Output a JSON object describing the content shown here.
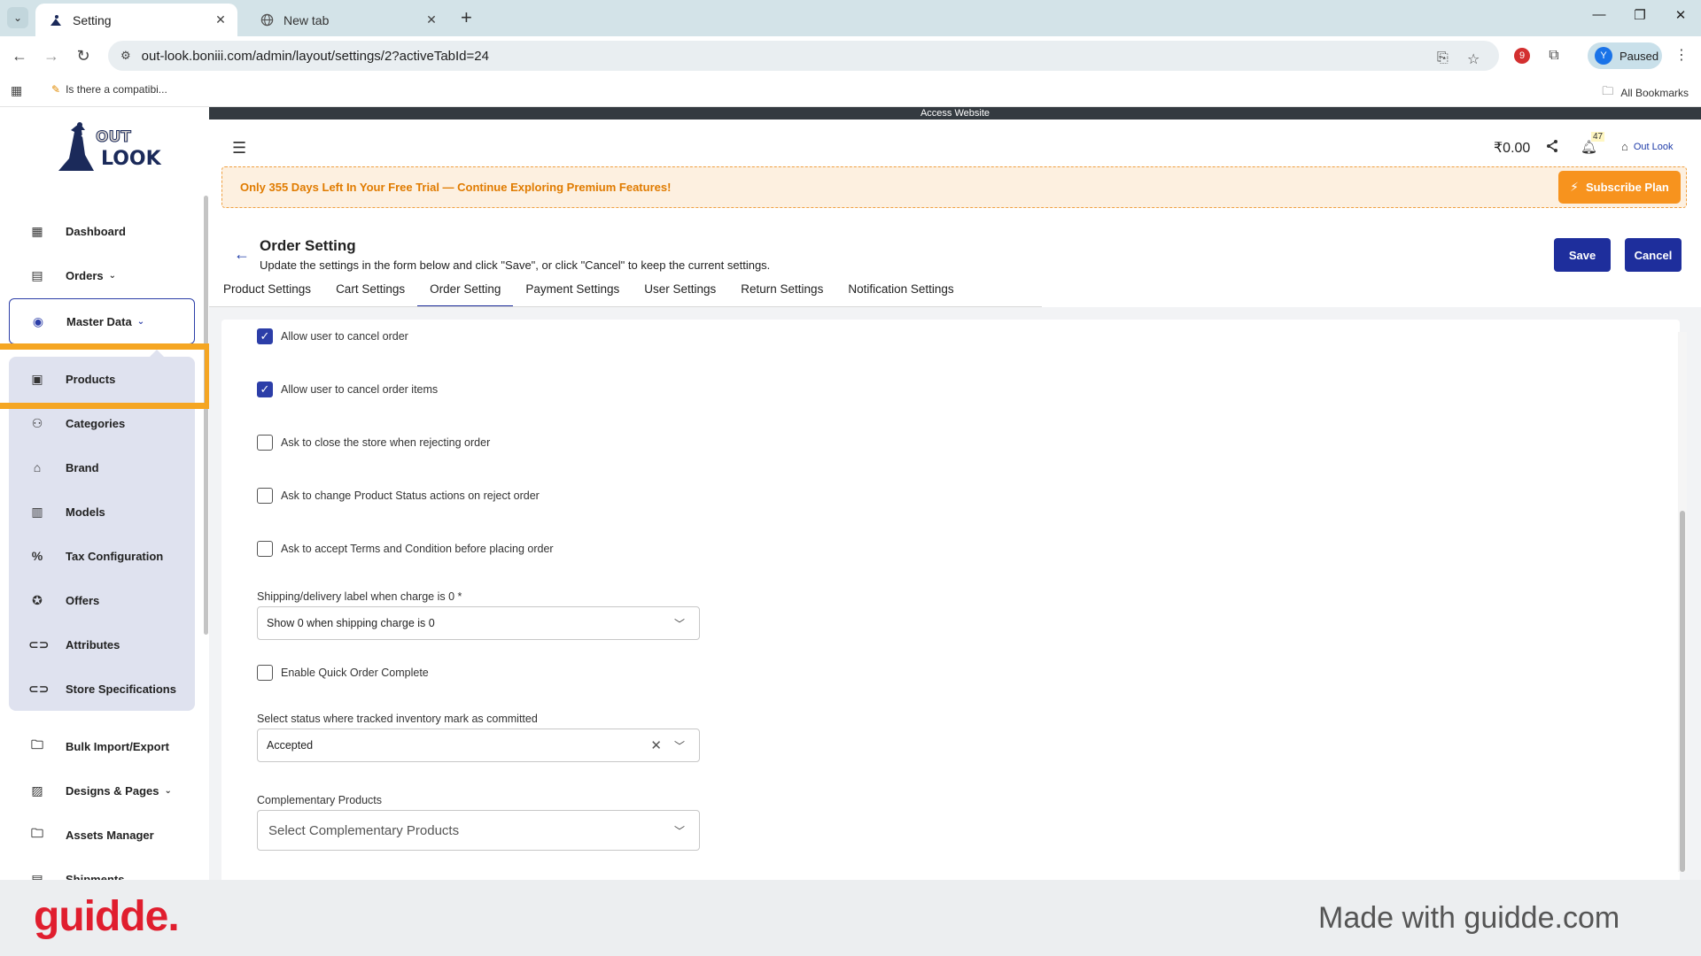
{
  "browser": {
    "tabs": [
      {
        "title": "Setting",
        "active": true
      },
      {
        "title": "New tab",
        "active": false
      }
    ],
    "url": "out-look.boniii.com/admin/layout/settings/2?activeTabId=24",
    "profile_initial": "Y",
    "profile_label": "Paused",
    "extension_badge": "9",
    "bookmark_item": "Is there a compatibi...",
    "all_bookmarks": "All Bookmarks"
  },
  "app": {
    "access_bar": "Access Website",
    "balance": "₹0.00",
    "notification_count": "47",
    "store_name": "Out Look",
    "trial_message": "Only 355 Days Left In Your Free Trial — Continue Exploring Premium Features!",
    "subscribe_label": "Subscribe Plan",
    "logo_text_top": "OUT",
    "logo_text_bottom": "LOOK"
  },
  "sidebar": {
    "items": [
      {
        "label": "Dashboard",
        "icon": "dashboard-icon"
      },
      {
        "label": "Orders",
        "icon": "orders-icon"
      },
      {
        "label": "Master Data",
        "icon": "master-data-icon"
      },
      {
        "label": "Products",
        "icon": "products-icon"
      },
      {
        "label": "Categories",
        "icon": "categories-icon"
      },
      {
        "label": "Brand",
        "icon": "tag-icon"
      },
      {
        "label": "Models",
        "icon": "models-icon"
      },
      {
        "label": "Tax Configuration",
        "icon": "percent-icon"
      },
      {
        "label": "Offers",
        "icon": "offers-icon"
      },
      {
        "label": "Attributes",
        "icon": "attributes-icon"
      },
      {
        "label": "Store Specifications",
        "icon": "specifications-icon"
      },
      {
        "label": "Bulk Import/Export",
        "icon": "folder-icon"
      },
      {
        "label": "Designs & Pages",
        "icon": "designs-icon"
      },
      {
        "label": "Assets Manager",
        "icon": "folder-icon"
      },
      {
        "label": "Shipments",
        "icon": "shipments-icon"
      }
    ]
  },
  "page": {
    "title": "Order Setting",
    "subtitle": "Update the settings in the form below and click \"Save\", or click \"Cancel\" to keep the current settings.",
    "save_label": "Save",
    "cancel_label": "Cancel",
    "tabs": [
      {
        "label": "Product Settings"
      },
      {
        "label": "Cart Settings"
      },
      {
        "label": "Order Setting"
      },
      {
        "label": "Payment Settings"
      },
      {
        "label": "User Settings"
      },
      {
        "label": "Return Settings"
      },
      {
        "label": "Notification Settings"
      }
    ],
    "active_tab": "Order Setting"
  },
  "form": {
    "checkboxes": [
      {
        "label": "Allow user to cancel order",
        "checked": true
      },
      {
        "label": "Allow user to cancel order items",
        "checked": true
      },
      {
        "label": "Ask to close the store when rejecting order",
        "checked": false
      },
      {
        "label": "Ask to change Product Status actions on reject order",
        "checked": false
      },
      {
        "label": "Ask to accept Terms and Condition before placing order",
        "checked": false
      }
    ],
    "shipping_label": "Shipping/delivery label when charge is 0 *",
    "shipping_value": "Show 0 when shipping charge is 0",
    "quick_order": {
      "label": "Enable Quick Order Complete",
      "checked": false
    },
    "inventory_label": "Select status where tracked inventory mark as committed",
    "inventory_value": "Accepted",
    "complementary_label": "Complementary Products",
    "complementary_placeholder": "Select Complementary Products"
  },
  "footer": {
    "brand": "guidde.",
    "made_with": "Made with guidde.com"
  },
  "colors": {
    "primary": "#1e2e9c",
    "accent_orange": "#f7931e",
    "highlight": "#f5a623",
    "brand_red": "#e01e2e"
  }
}
